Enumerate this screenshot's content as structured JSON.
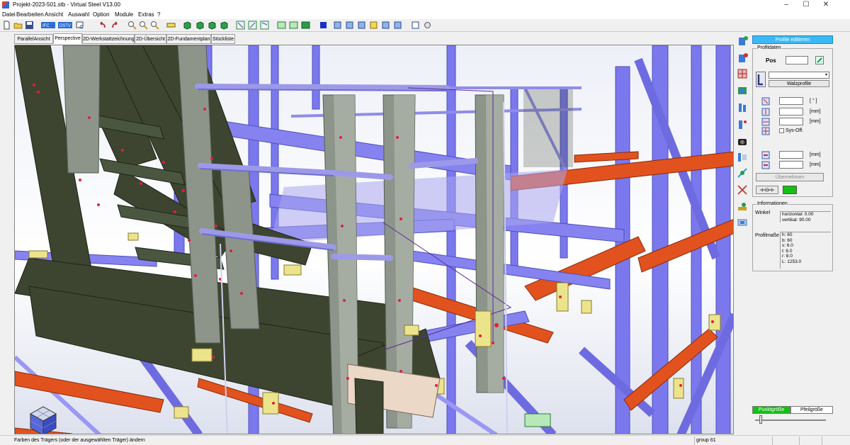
{
  "window": {
    "title": "Projekt-2023-501.stb - Virtual Steel V13.00",
    "minimize": "–",
    "maximize": "☐",
    "close": "✕"
  },
  "menu": [
    "Datei",
    "Bearbeiten",
    "Ansicht",
    "Auswahl",
    "Option",
    "Module",
    "Extras",
    "?"
  ],
  "toolbar": {
    "icons": [
      "new-file-icon",
      "open-folder-icon",
      "save-icon",
      "import-icon",
      "export-icon",
      "print-preview-icon",
      "undo-icon",
      "redo-icon",
      "zoom-in-icon",
      "zoom-out-icon",
      "zoom-fit-icon",
      "frame-icon",
      "view-iso-1-icon",
      "view-iso-2-icon",
      "view-iso-3-icon",
      "view-iso-4-icon",
      "view-front-icon",
      "view-side-icon",
      "view-top-icon",
      "window-1-icon",
      "window-2-icon",
      "window-3-icon",
      "color-icon",
      "tool-1-icon",
      "tool-2-icon",
      "tool-3-icon",
      "tool-4-icon",
      "tool-5-icon",
      "tool-6-icon",
      "tool-7-icon",
      "tool-8-icon"
    ]
  },
  "tabs": [
    {
      "label": "ParallelAnsicht",
      "active": false
    },
    {
      "label": "Perspective",
      "active": true
    },
    {
      "label": "2D-Werkstattzeichnung",
      "active": false
    },
    {
      "label": "2D-Übersicht",
      "active": false
    },
    {
      "label": "2D-Fundamentplan",
      "active": false
    },
    {
      "label": "Stückliste",
      "active": false
    }
  ],
  "right_strip_icons": [
    "profile-add-icon",
    "profile-edit-icon",
    "grid-icon",
    "beam-icon",
    "column-icon",
    "brace-icon",
    "camera-icon",
    "section-icon",
    "connection-icon",
    "cut-icon",
    "weld-icon",
    "layer-icon"
  ],
  "panel": {
    "edit_button": "Profile editieren",
    "profile_group": "Profildaten",
    "pos_label": "Pos",
    "profile_button": "Walzprofile",
    "unit_angle": "[ ° ]",
    "unit_mm": "[mm]",
    "sys_off_label": "Sys-Off.",
    "apply_button": "Übernehmen",
    "info_group": "Informationen",
    "winkel_label": "Winkel",
    "winkel_values": "horizontal: 0.00\nvertikal: 90.00",
    "profilmasse_label": "Profilmaße",
    "profilmasse_values": "h: 60\nb: 60\ns: 6.0\nt: 6.0\nr: 8.0\nL: 1253.0",
    "tab_point": "Punktgröße",
    "tab_arrow": "Pfeilgröße",
    "swatch_color": "#13c013"
  },
  "status": {
    "message": "Farben des Trägers (oder der ausgewählten Träger) ändern",
    "group": "group 61"
  },
  "colors": {
    "steel_blue": "#7b78ee",
    "steel_dark": "#4a4fb8",
    "stair_green": "#3d4530",
    "beam_orange": "#e2521e",
    "grey_post": "#8d958a",
    "plate_yellow": "#ece48a",
    "bolt_red": "#e0203a"
  }
}
